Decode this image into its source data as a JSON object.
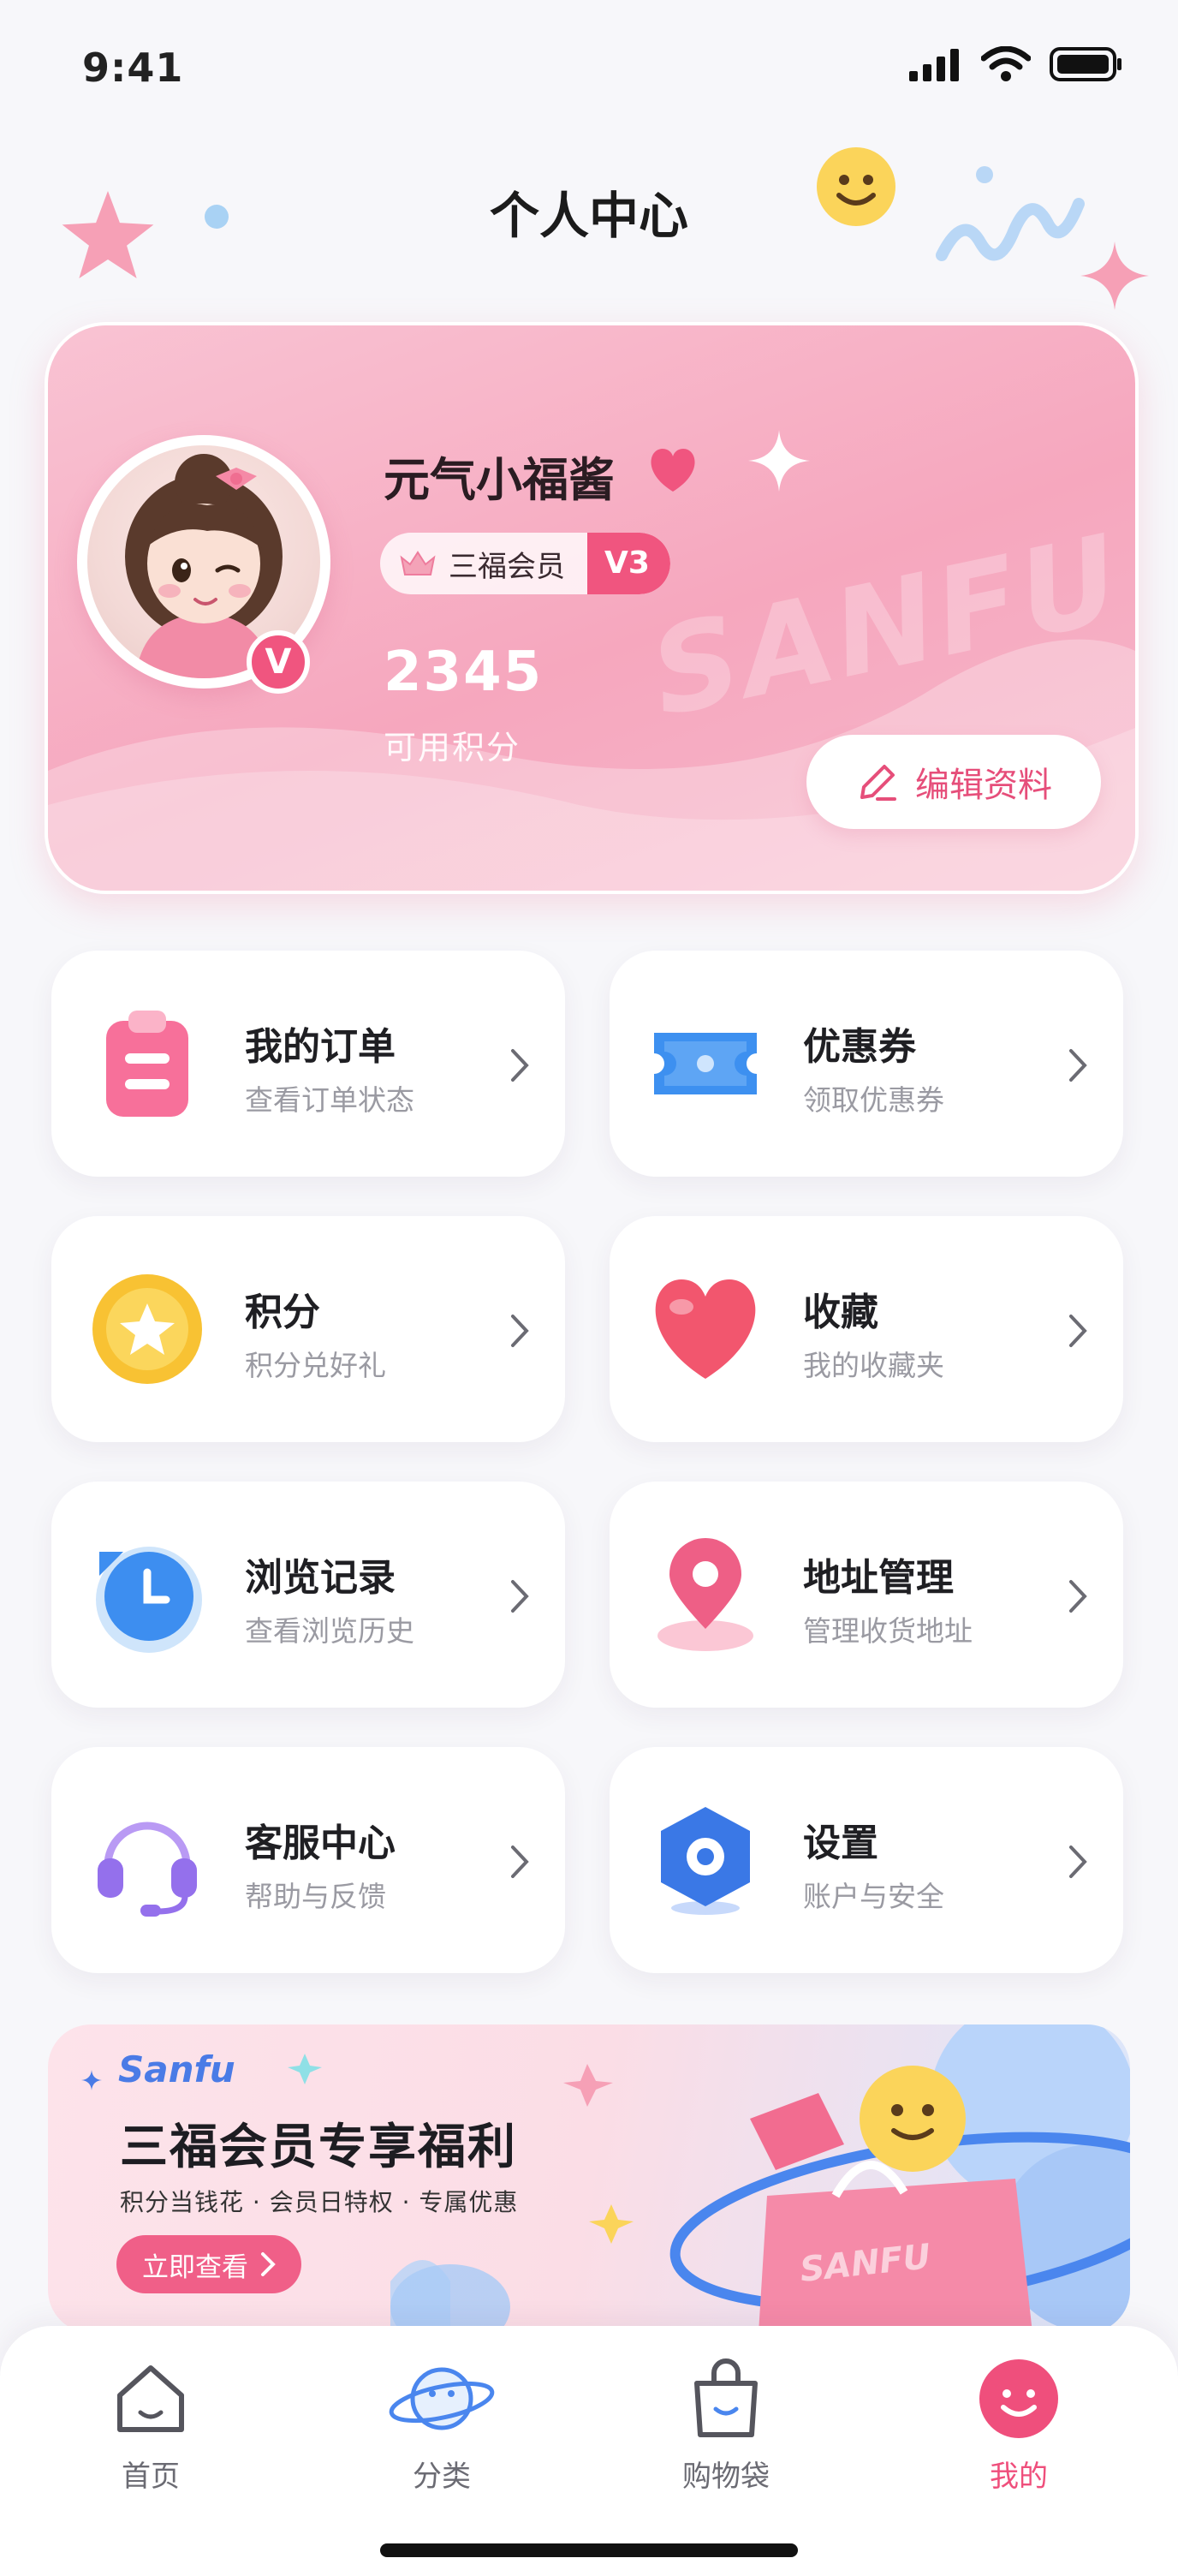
{
  "status_bar": {
    "time": "9:41"
  },
  "header": {
    "title": "个人中心"
  },
  "profile": {
    "username": "元气小福酱",
    "member_label": "三福会员",
    "level": "V3",
    "avatar_badge": "V",
    "points_value": "2345",
    "points_label": "可用积分",
    "edit_label": "编辑资料",
    "watermark": "SANFU"
  },
  "menu": [
    {
      "title": "我的订单",
      "subtitle": "查看订单状态",
      "icon": "clipboard-icon"
    },
    {
      "title": "优惠券",
      "subtitle": "领取优惠券",
      "icon": "coupon-icon"
    },
    {
      "title": "积分",
      "subtitle": "积分兑好礼",
      "icon": "star-coin-icon"
    },
    {
      "title": "收藏",
      "subtitle": "我的收藏夹",
      "icon": "heart-icon"
    },
    {
      "title": "浏览记录",
      "subtitle": "查看浏览历史",
      "icon": "clock-icon"
    },
    {
      "title": "地址管理",
      "subtitle": "管理收货地址",
      "icon": "location-pin-icon"
    },
    {
      "title": "客服中心",
      "subtitle": "帮助与反馈",
      "icon": "headset-icon"
    },
    {
      "title": "设置",
      "subtitle": "账户与安全",
      "icon": "settings-hexagon-icon"
    }
  ],
  "promo": {
    "brand": "Sanfu",
    "title": "三福会员专享福利",
    "subtitle": "积分当钱花 · 会员日特权 · 专属优惠",
    "cta": "立即查看",
    "bag_text": "SANFU"
  },
  "tabbar": {
    "items": [
      {
        "label": "首页",
        "icon": "home-icon"
      },
      {
        "label": "分类",
        "icon": "planet-icon"
      },
      {
        "label": "购物袋",
        "icon": "shopping-bag-icon"
      },
      {
        "label": "我的",
        "icon": "smiley-profile-icon"
      }
    ],
    "active_index": 3
  },
  "colors": {
    "accent": "#ef4f7c",
    "card_pink": "#f6a7be",
    "blue": "#4a7be6"
  }
}
